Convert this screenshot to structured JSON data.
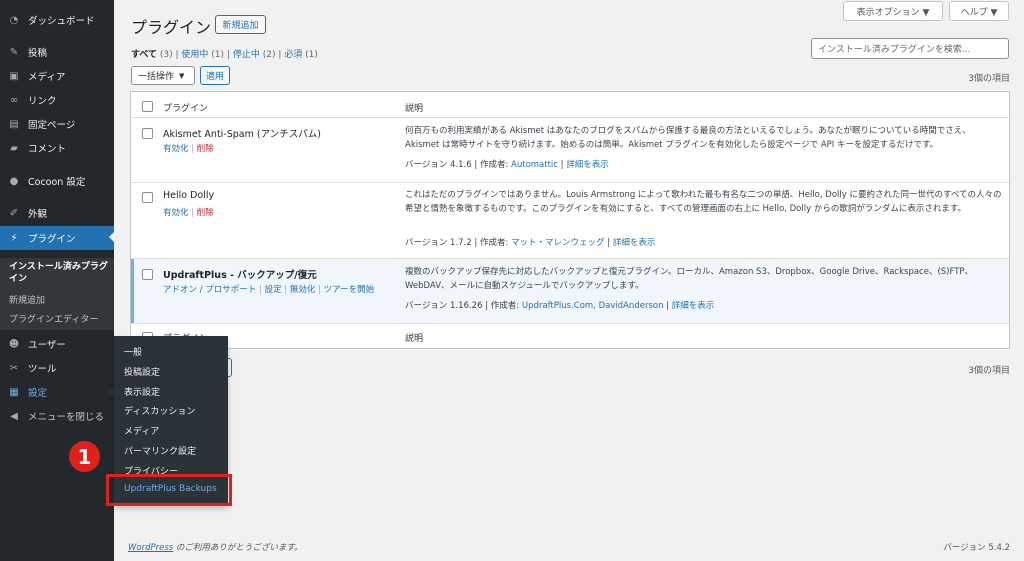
{
  "sidebar": {
    "items": [
      {
        "name": "dashboard",
        "label": "ダッシュボード",
        "icon": "dashboard-icon"
      },
      {
        "name": "posts",
        "label": "投稿",
        "icon": "pin-icon"
      },
      {
        "name": "media",
        "label": "メディア",
        "icon": "media-icon"
      },
      {
        "name": "links",
        "label": "リンク",
        "icon": "link-icon"
      },
      {
        "name": "pages",
        "label": "固定ページ",
        "icon": "page-icon"
      },
      {
        "name": "comments",
        "label": "コメント",
        "icon": "comment-icon"
      },
      {
        "name": "cocoon",
        "label": "Cocoon 設定",
        "icon": "cocoon-icon"
      },
      {
        "name": "appearance",
        "label": "外観",
        "icon": "brush-icon"
      },
      {
        "name": "plugins",
        "label": "プラグイン",
        "icon": "plugin-icon"
      },
      {
        "name": "users",
        "label": "ユーザー",
        "icon": "user-icon"
      },
      {
        "name": "tools",
        "label": "ツール",
        "icon": "wrench-icon"
      },
      {
        "name": "settings",
        "label": "設定",
        "icon": "settings-icon"
      },
      {
        "name": "collapse",
        "label": "メニューを閉じる",
        "icon": "collapse-icon"
      }
    ],
    "plugins_submenu": [
      "インストール済みプラグイン",
      "新規追加",
      "プラグインエディター"
    ]
  },
  "settings_flyout": [
    "一般",
    "投稿設定",
    "表示設定",
    "ディスカッション",
    "メディア",
    "パーマリンク設定",
    "プライバシー",
    "UpdraftPlus Backups"
  ],
  "step_badge": "1",
  "header": {
    "title": "プラグイン",
    "add_new": "新規追加",
    "screen_options": "表示オプション ▼",
    "help": "ヘルプ ▼"
  },
  "filters": {
    "all": "すべて",
    "all_count": "(3)",
    "active": "使用中",
    "active_count": "(1)",
    "inactive": "停止中",
    "inactive_count": "(2)",
    "must_use": "必須",
    "must_use_count": "(1)"
  },
  "search": {
    "placeholder": "インストール済みプラグインを検索..."
  },
  "bulk": {
    "select": "一括操作",
    "apply": "適用",
    "count": "3個の項目"
  },
  "table": {
    "col_plugin": "プラグイン",
    "col_desc": "説明",
    "version_label": "バージョン",
    "author_label": "作成者:",
    "details": "詳細を表示",
    "rows": [
      {
        "name": "Akismet Anti-Spam (アンチスパム)",
        "actions": [
          "有効化",
          "削除"
        ],
        "description": "何百万もの利用実績がある Akismet はあなたのブログをスパムから保護する最良の方法といえるでしょう。あなたが眠りについている時間でさえ、Akismet は常時サイトを守り続けます。始めるのは簡単。Akismet プラグインを有効化したら設定ページで API キーを設定するだけです。",
        "version": "4.1.6",
        "author": "Automattic"
      },
      {
        "name": "Hello Dolly",
        "actions": [
          "有効化",
          "削除"
        ],
        "description": "これはただのプラグインではありません。Louis Armstrong によって歌われた最も有名な二つの単語、Hello, Dolly に要約された同一世代のすべての人々の希望と情熱を象徴するものです。このプラグインを有効にすると、すべての管理画面の右上に Hello, Dolly からの歌詞がランダムに表示されます。",
        "version": "1.7.2",
        "author": "マット・マレンウェッグ"
      },
      {
        "name": "UpdraftPlus - バックアップ/復元",
        "actions": [
          "アドオン / プロサポート",
          "設定",
          "無効化",
          "ツアーを開始"
        ],
        "description": "複数のバックアップ保存先に対応したバックアップと復元プラグイン。ローカル、Amazon S3、Dropbox、Google Drive、Rackspace、(S)FTP、WebDAV、メールに自動スケジュールでバックアップします。",
        "version": "1.16.26",
        "author": "UpdraftPlus.Com, DavidAnderson"
      }
    ]
  },
  "footer": {
    "wordpress": "WordPress",
    "thanks": " のご利用ありがとうございます。",
    "version": "バージョン 5.4.2"
  }
}
